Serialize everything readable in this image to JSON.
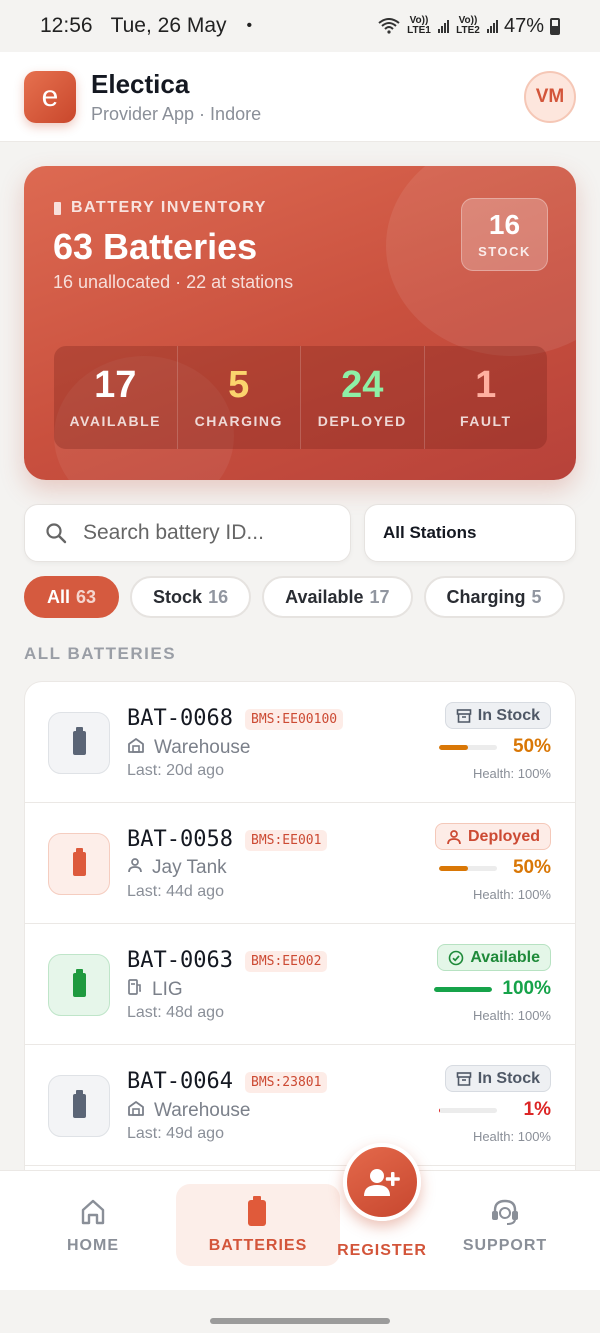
{
  "status_bar": {
    "time": "12:56",
    "date": "Tue, 26 May",
    "dot": "•",
    "wifi_label": "6",
    "sim1_label": "Vo)) LTE1",
    "sim2_label": "Vo)) LTE2",
    "battery": "47%"
  },
  "header": {
    "logo_letter": "e",
    "app_name": "Electica",
    "subtitle": "Provider App · Indore",
    "avatar_initials": "VM"
  },
  "inventory": {
    "label": "BATTERY INVENTORY",
    "title": "63 Batteries",
    "subline": "16 unallocated · 22 at stations",
    "stock_count": "16",
    "stock_label": "STOCK",
    "stats": [
      {
        "value": "17",
        "label": "AVAILABLE",
        "color": "#ffffff"
      },
      {
        "value": "5",
        "label": "CHARGING",
        "color": "#fbd46d"
      },
      {
        "value": "24",
        "label": "DEPLOYED",
        "color": "#8ef0a6"
      },
      {
        "value": "1",
        "label": "FAULT",
        "color": "#ffb0a0"
      }
    ]
  },
  "search": {
    "placeholder": "Search battery ID...",
    "station_filter": "All Stations"
  },
  "filters": [
    {
      "label": "All",
      "count": "63",
      "active": true
    },
    {
      "label": "Stock",
      "count": "16",
      "active": false
    },
    {
      "label": "Available",
      "count": "17",
      "active": false
    },
    {
      "label": "Charging",
      "count": "5",
      "active": false
    }
  ],
  "section_title": "ALL BATTERIES",
  "batteries": [
    {
      "id": "BAT-0068",
      "bms": "BMS:EE00100",
      "location": "Warehouse",
      "location_icon": "warehouse-icon",
      "last": "Last: 20d ago",
      "status": "In Stock",
      "status_icon": "box-icon",
      "charge": "50%",
      "charge_fraction": 0.5,
      "charge_color": "#d97706",
      "health": "Health: 100%",
      "tone": "gray"
    },
    {
      "id": "BAT-0058",
      "bms": "BMS:EE001",
      "location": "Jay Tank",
      "location_icon": "person-icon",
      "last": "Last: 44d ago",
      "status": "Deployed",
      "status_icon": "person-icon",
      "charge": "50%",
      "charge_fraction": 0.5,
      "charge_color": "#d97706",
      "health": "Health: 100%",
      "tone": "red"
    },
    {
      "id": "BAT-0063",
      "bms": "BMS:EE002",
      "location": "LIG",
      "location_icon": "station-icon",
      "last": "Last: 48d ago",
      "status": "Available",
      "status_icon": "check-circle-icon",
      "charge": "100%",
      "charge_fraction": 1.0,
      "charge_color": "#16a34a",
      "health": "Health: 100%",
      "tone": "green"
    },
    {
      "id": "BAT-0064",
      "bms": "BMS:23801",
      "location": "Warehouse",
      "location_icon": "warehouse-icon",
      "last": "Last: 49d ago",
      "status": "In Stock",
      "status_icon": "box-icon",
      "charge": "1%",
      "charge_fraction": 0.01,
      "charge_color": "#dc2626",
      "health": "Health: 100%",
      "tone": "gray"
    }
  ],
  "nav": {
    "home": "HOME",
    "batteries": "BATTERIES",
    "register": "REGISTER",
    "support": "SUPPORT"
  }
}
